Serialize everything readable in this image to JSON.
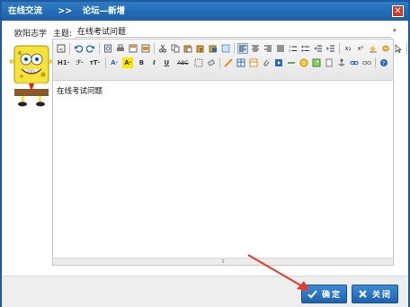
{
  "window": {
    "title_section": "在线交流",
    "separator": ">>",
    "title_page": "论坛—新增",
    "close_glyph": "✕"
  },
  "form": {
    "author_name": "欧阳志学",
    "subject_label": "主题:",
    "subject_value": "在线考试问题",
    "required_mark": "▾"
  },
  "editor": {
    "body_text": "在线考试问题",
    "toolbar": {
      "heading_label": "H1·",
      "font_label": "ℱ·",
      "size_label": "ᴛT·",
      "font_color_label": "A·",
      "highlight_label": "A·",
      "bold": "B",
      "italic": "I",
      "underline": "U",
      "strike": "ABC",
      "superscript": "x²",
      "subscript": "x₂"
    },
    "resize_glyph": "⇕"
  },
  "buttons": {
    "confirm": "确定",
    "close": "关闭"
  },
  "colors": {
    "title_bar": "#1b5fa8",
    "button": "#1e62ac",
    "annotation_arrow": "#e53b2c"
  },
  "icons": [
    "check-icon",
    "x-icon",
    "spongebob-avatar"
  ]
}
